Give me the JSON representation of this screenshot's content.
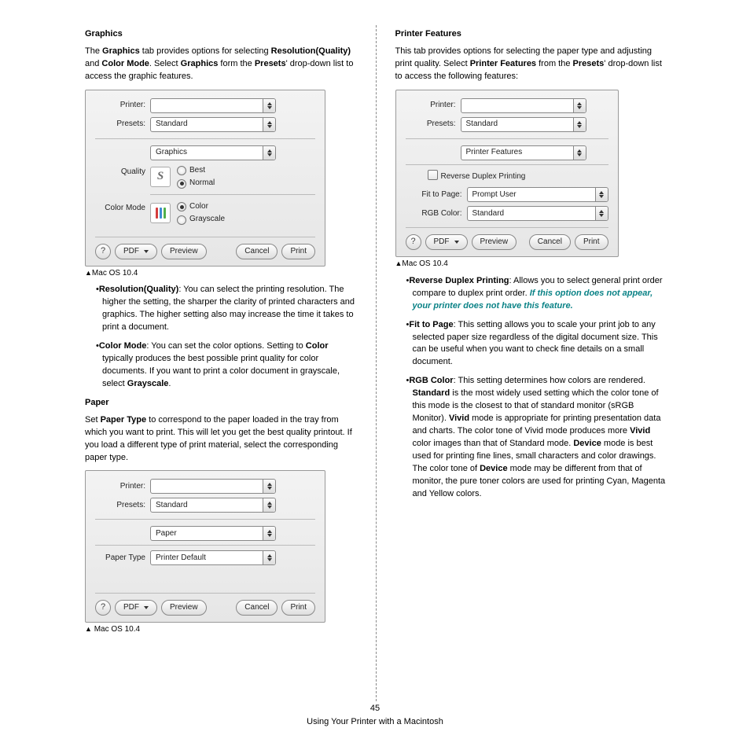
{
  "page_number": "45",
  "footer": "Using Your Printer with a Macintosh",
  "mac_caption": "Mac OS 10.4",
  "left": {
    "header_graphics": "Graphics",
    "graphics_para_1a": "The ",
    "graphics_para_1b": "Graphics",
    "graphics_para_1c": " tab provides options for selecting ",
    "graphics_para_1d": "Resolution(Quality)",
    "graphics_para_1e": " and ",
    "graphics_para_1f": "Color Mode",
    "graphics_para_1g": ". Select ",
    "graphics_para_1h": "Graphics",
    "graphics_para_1i": " form the ",
    "graphics_para_1j": "Presets",
    "graphics_para_1k": "' drop-down list to access the graphic features.",
    "bul1_a": "Resolution(Quality)",
    "bul1_b": ": You can select the printing resolution. The higher the setting, the sharper the clarity of printed characters and graphics. The higher setting also may increase the time it takes to print a document.",
    "bul2_a": "Color Mode",
    "bul2_b": ": You can set the color options. Setting to ",
    "bul2_c": "Color",
    "bul2_d": " typically produces the best possible print quality for color documents. If you want to print a color document in grayscale, select ",
    "bul2_e": "Grayscale",
    "bul2_f": ".",
    "header_paper": "Paper",
    "paper_para_a": "Set ",
    "paper_para_b": "Paper Type",
    "paper_para_c": " to correspond to the paper loaded in the tray from which you want to print. This will let you get the best quality printout. If you load a different type of print material, select the corresponding paper type."
  },
  "right": {
    "header_pf": "Printer Features",
    "pf_para_a": "This tab provides options for selecting the paper type and adjusting print quality. Select ",
    "pf_para_b": "Printer Features",
    "pf_para_c": " from the ",
    "pf_para_d": "Presets",
    "pf_para_e": "' drop-down list to access the following features:",
    "bul1_a": "Reverse Duplex Printing",
    "bul1_b": ": Allows you to select general print order compare to duplex print order.  ",
    "bul1_c": "If this option does not appear, your printer does not have this feature.",
    "bul2_a": "Fit to Page",
    "bul2_b": ": This setting allows you to scale your print job to any selected paper size regardless of the digital document size. This can be useful when you want to check fine details on a small document.",
    "bul3_a": "RGB Color",
    "bul3_b": ": This setting determines how colors are rendered. ",
    "bul3_c": "Standard",
    "bul3_d": " is the most widely used setting which the color tone of this mode is the closest to that of standard monitor (sRGB Monitor). ",
    "bul3_e": "Vivid",
    "bul3_f": " mode is appropriate for printing presentation data and charts. The color tone of Vivid mode produces more ",
    "bul3_g": "Vivid",
    "bul3_h": " color images than that of Standard mode. ",
    "bul3_i": "Device",
    "bul3_j": " mode is best used for printing fine lines, small characters and color drawings. The color tone of ",
    "bul3_k": "Device",
    "bul3_l": " mode may be different from that of monitor, the pure toner colors are used for printing Cyan, Magenta and Yellow colors."
  },
  "dialog": {
    "printer_label": "Printer:",
    "presets_label": "Presets:",
    "presets_value": "Standard",
    "pane_graphics": "Graphics",
    "pane_paper": "Paper",
    "pane_pf": "Printer Features",
    "quality_label": "Quality",
    "quality_best": "Best",
    "quality_normal": "Normal",
    "colormode_label": "Color Mode",
    "colormode_color": "Color",
    "colormode_gray": "Grayscale",
    "papertype_label": "Paper Type",
    "papertype_value": "Printer Default",
    "reverse_duplex": "Reverse Duplex Printing",
    "fit_label": "Fit to Page:",
    "fit_value": "Prompt User",
    "rgb_label": "RGB Color:",
    "rgb_value": "Standard",
    "help": "?",
    "pdf": "PDF",
    "preview": "Preview",
    "cancel": "Cancel",
    "print": "Print",
    "swatch_s": "S"
  }
}
